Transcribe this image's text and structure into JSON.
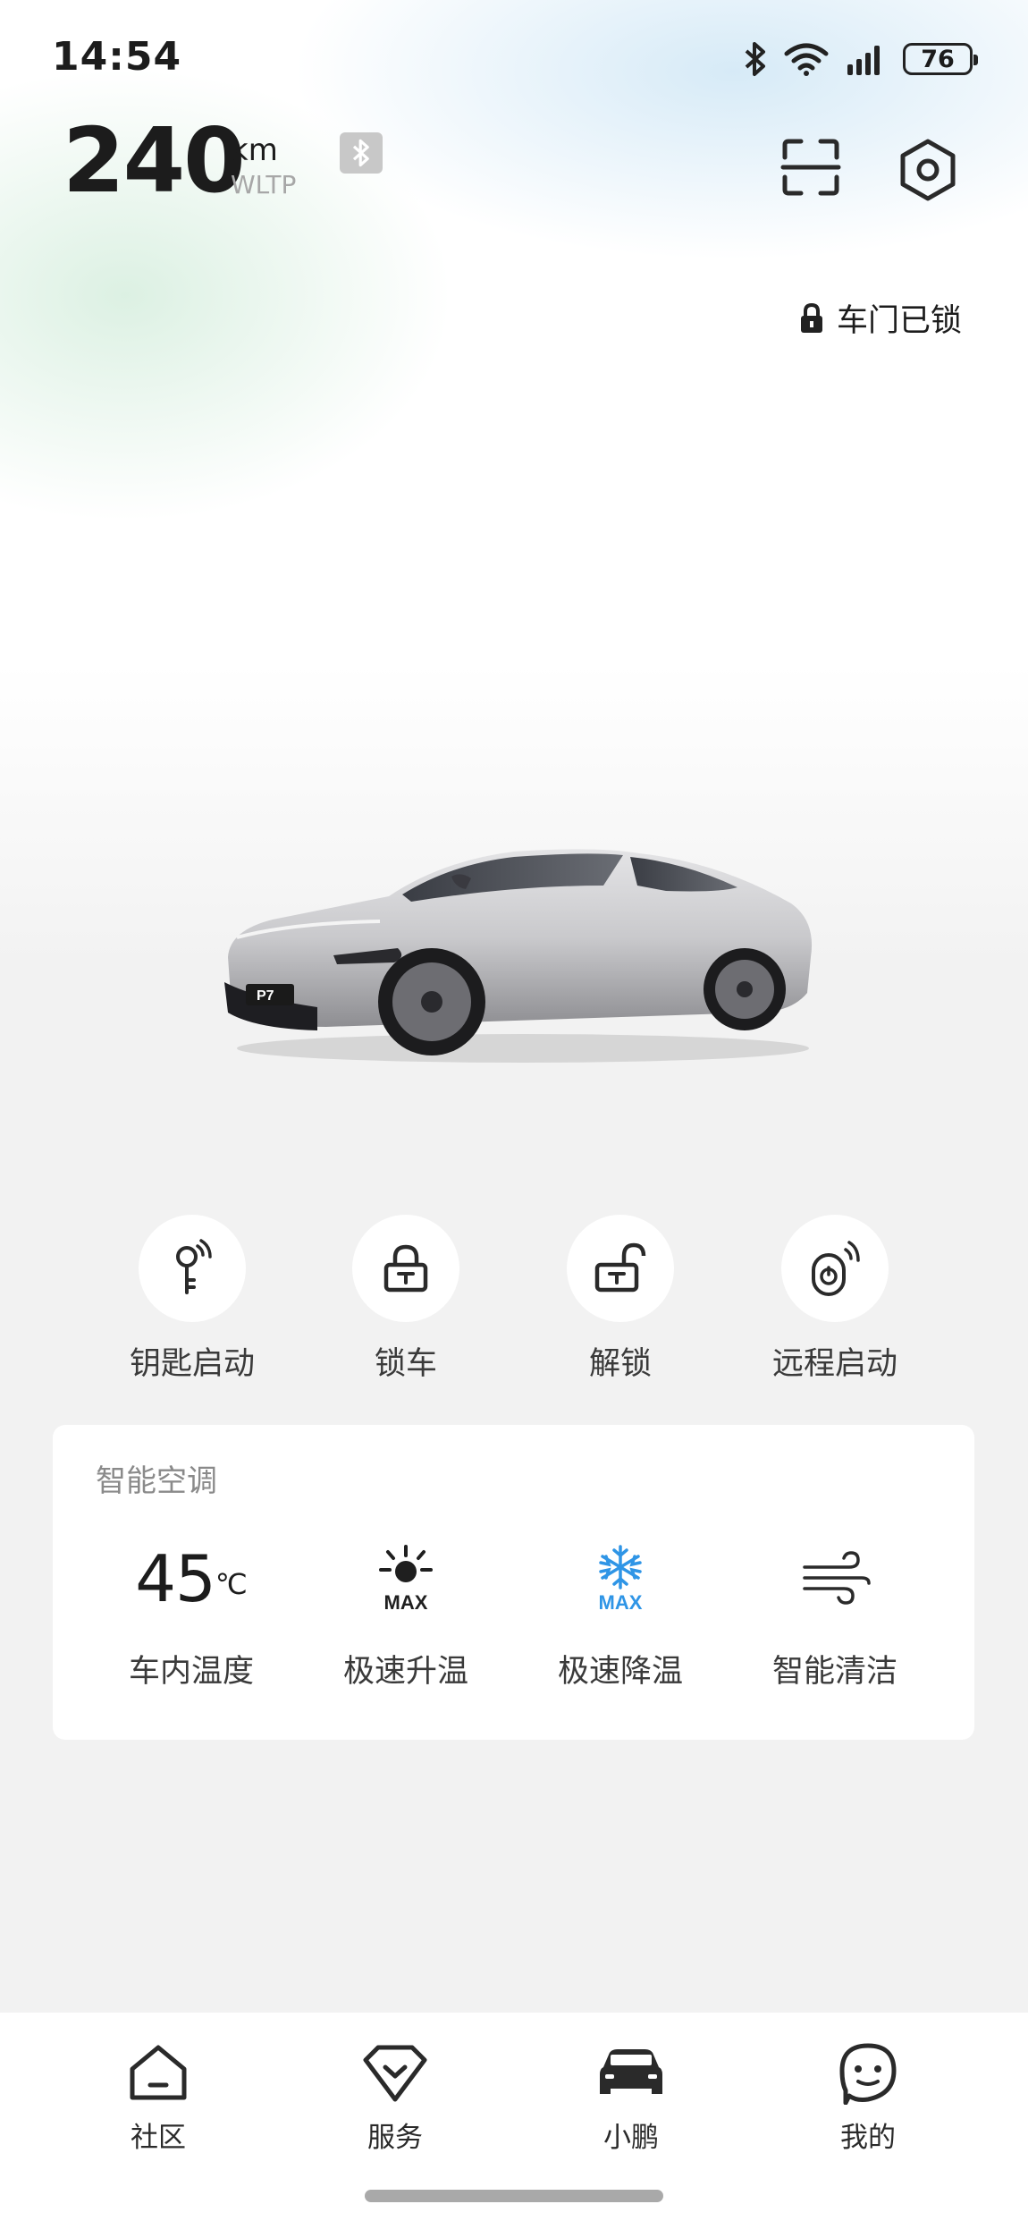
{
  "status_bar": {
    "time": "14:54",
    "battery": "76",
    "icons": [
      "bluetooth-icon",
      "wifi-icon",
      "signal-icon",
      "battery-icon"
    ]
  },
  "vehicle": {
    "range_value": "240",
    "range_unit": "km",
    "range_standard": "WLTP",
    "door_status": "车门已锁",
    "model_badge": "P7"
  },
  "actions": [
    {
      "label": "钥匙启动",
      "icon": "key-start-icon"
    },
    {
      "label": "锁车",
      "icon": "lock-icon"
    },
    {
      "label": "解锁",
      "icon": "unlock-icon"
    },
    {
      "label": "远程启动",
      "icon": "remote-start-icon"
    }
  ],
  "climate": {
    "title": "智能空调",
    "temperature": "45",
    "temperature_unit": "℃",
    "items": [
      {
        "label": "车内温度"
      },
      {
        "label": "极速升温",
        "badge": "MAX",
        "icon": "sun-max-icon"
      },
      {
        "label": "极速降温",
        "badge": "MAX",
        "icon": "snowflake-max-icon"
      },
      {
        "label": "智能清洁",
        "icon": "wind-icon"
      }
    ],
    "colors": {
      "cool_accent": "#2f95e6"
    }
  },
  "nav": [
    {
      "label": "社区",
      "icon": "home-icon"
    },
    {
      "label": "服务",
      "icon": "service-shield-icon"
    },
    {
      "label": "小鹏",
      "icon": "car-icon",
      "active": true
    },
    {
      "label": "我的",
      "icon": "profile-face-icon"
    }
  ]
}
